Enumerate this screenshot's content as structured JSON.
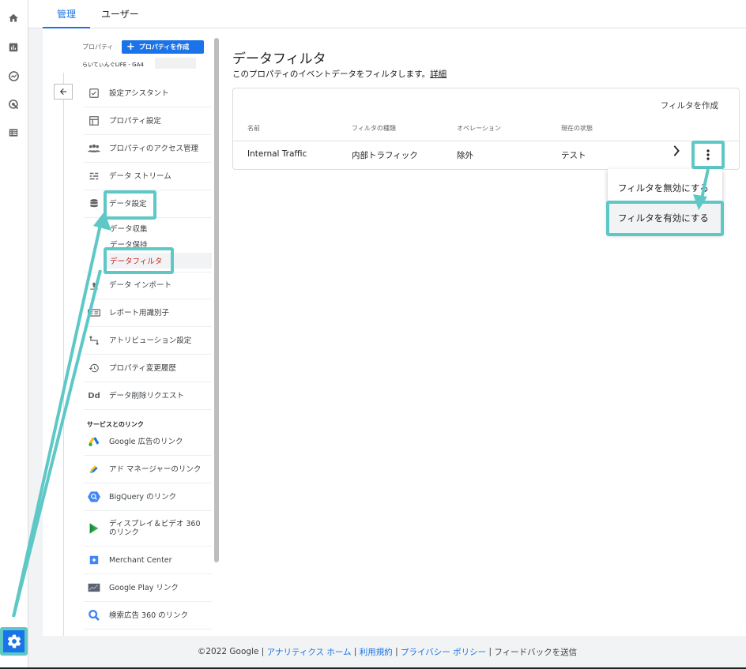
{
  "tabs": {
    "admin": "管理",
    "user": "ユーザー"
  },
  "property": {
    "label": "プロパティ",
    "create_button": "プロパティを作成",
    "name": "らいてぃんぐLIFE - GA4"
  },
  "nav": {
    "items": [
      {
        "label": "設定アシスタント",
        "icon": "checklist-icon"
      },
      {
        "label": "プロパティ設定",
        "icon": "layout-icon"
      },
      {
        "label": "プロパティのアクセス管理",
        "icon": "people-icon"
      },
      {
        "label": "データ ストリーム",
        "icon": "streams-icon"
      },
      {
        "label": "データ設定",
        "icon": "database-icon"
      },
      {
        "label": "データ インポート",
        "icon": "upload-icon"
      },
      {
        "label": "レポート用識別子",
        "icon": "identifier-icon"
      },
      {
        "label": "アトリビューション設定",
        "icon": "attribution-icon"
      },
      {
        "label": "プロパティ変更履歴",
        "icon": "history-icon"
      },
      {
        "label": "データ削除リクエスト",
        "icon": "dd-icon",
        "icon_text": "Dd"
      }
    ],
    "sub_items": [
      "データ収集",
      "データ保持",
      "データフィルタ"
    ],
    "section_links": "サービスとのリンク",
    "links": [
      {
        "label": "Google 広告のリンク",
        "icon": "google-ads-icon"
      },
      {
        "label": "アド マネージャーのリンク",
        "icon": "ad-manager-icon"
      },
      {
        "label": "BigQuery のリンク",
        "icon": "bigquery-icon"
      },
      {
        "label": "ディスプレイ＆ビデオ 360 のリンク",
        "label_line1": "ディスプレイ＆ビデオ 360",
        "label_line2": "のリンク",
        "icon": "dv360-icon"
      },
      {
        "label": "Merchant Center",
        "icon": "merchant-center-icon"
      },
      {
        "label": "Google Play リンク",
        "icon": "google-play-icon"
      },
      {
        "label": "検索広告 360 のリンク",
        "icon": "search-ads-icon"
      }
    ]
  },
  "main": {
    "title": "データフィルタ",
    "description": "このプロパティのイベントデータをフィルタします。",
    "details_link": "詳細",
    "create_filter": "フィルタを作成",
    "columns": [
      "名前",
      "フィルタの種類",
      "オペレーション",
      "現在の状態"
    ],
    "rows": [
      {
        "name": "Internal Traffic",
        "type": "内部トラフィック",
        "operation": "除外",
        "state": "テスト"
      }
    ],
    "menu": [
      "フィルタを無効にする",
      "フィルタを有効にする"
    ]
  },
  "footer": {
    "copyright": "©2022 Google",
    "links": [
      "アナリティクス ホーム",
      "利用規約",
      "プライバシー ポリシー"
    ],
    "feedback": "フィードバックを送信"
  },
  "colors": {
    "accent": "#1a73e8",
    "highlight": "#5ec8c6",
    "active_subitem": "#c5221f"
  }
}
